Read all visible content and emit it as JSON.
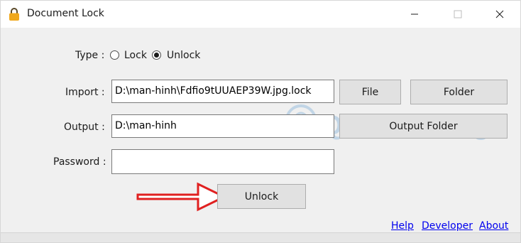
{
  "window": {
    "title": "Document Lock",
    "icon": "padlock-icon",
    "accent_color": "#f0a81c"
  },
  "type_row": {
    "label": "Type :",
    "options": [
      {
        "label": "Lock",
        "checked": false
      },
      {
        "label": "Unlock",
        "checked": true
      }
    ]
  },
  "import_row": {
    "label": "Import :",
    "value": "D:\\man-hinh\\Fdfio9tUUAEP39W.jpg.lock",
    "file_button": "File",
    "folder_button": "Folder"
  },
  "output_row": {
    "label": "Output :",
    "value": "D:\\man-hinh",
    "folder_button": "Output Folder"
  },
  "password_row": {
    "label": "Password :",
    "value": ""
  },
  "action": {
    "unlock_button": "Unlock",
    "arrow_color": "#e02020"
  },
  "footer_links": {
    "help": "Help",
    "developer": "Developer",
    "about": "About"
  },
  "watermark": {
    "text": "Quantrimang"
  }
}
